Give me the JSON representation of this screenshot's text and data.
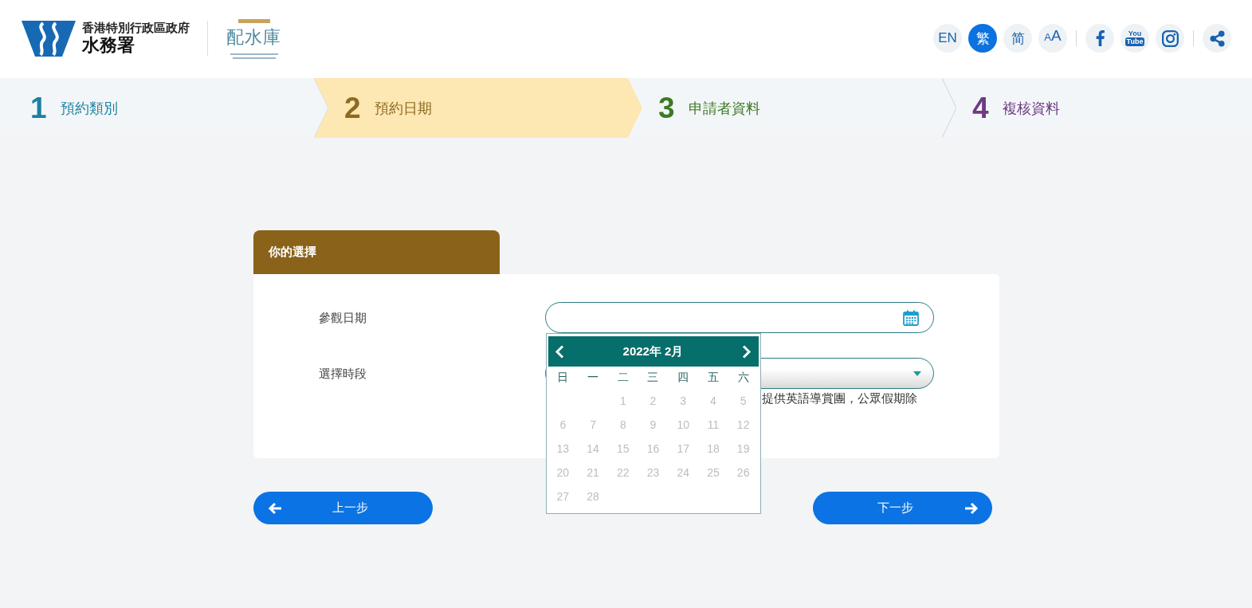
{
  "header": {
    "org_name": "香港特別行政區政府",
    "department": "水務署",
    "partner_logo": "配水庫",
    "languages": [
      {
        "label": "EN",
        "selected": false
      },
      {
        "label": "繁",
        "selected": true
      },
      {
        "label": "简",
        "selected": false
      }
    ],
    "font_size_button": {
      "small": "A",
      "large": "A"
    },
    "social": [
      {
        "kind": "facebook"
      },
      {
        "kind": "youtube",
        "top": "You",
        "bottom": "Tube"
      },
      {
        "kind": "instagram"
      }
    ]
  },
  "steps": [
    {
      "number": "1",
      "label": "預約類別",
      "color": "#1b80a0",
      "selected": false
    },
    {
      "number": "2",
      "label": "預約日期",
      "color": "#8e6a22",
      "selected": true
    },
    {
      "number": "3",
      "label": "申請者資料",
      "color": "#3e7a26",
      "selected": false
    },
    {
      "number": "4",
      "label": "複核資料",
      "color": "#6e3b82",
      "selected": false
    }
  ],
  "selection_panel": {
    "title": "你的選擇",
    "fields": [
      {
        "kind": "date",
        "label": "參觀日期",
        "calendar": {
          "title": "2022年 2月",
          "weekdays": [
            "日",
            "一",
            "二",
            "三",
            "四",
            "五",
            "六"
          ],
          "weeks": [
            {
              "flush_right": true,
              "days": [
                {
                  "day": "1",
                  "disabled": true
                },
                {
                  "day": "2",
                  "disabled": true
                },
                {
                  "day": "3",
                  "disabled": true
                },
                {
                  "day": "4",
                  "disabled": true
                },
                {
                  "day": "5",
                  "disabled": true
                }
              ]
            },
            {
              "days": [
                {
                  "day": "6",
                  "disabled": true
                },
                {
                  "day": "7",
                  "disabled": true
                },
                {
                  "day": "8",
                  "disabled": true
                },
                {
                  "day": "9",
                  "disabled": true
                },
                {
                  "day": "10",
                  "disabled": true
                },
                {
                  "day": "11",
                  "disabled": true
                },
                {
                  "day": "12",
                  "disabled": true
                }
              ]
            },
            {
              "days": [
                {
                  "day": "13",
                  "disabled": true
                },
                {
                  "day": "14",
                  "disabled": true
                },
                {
                  "day": "15",
                  "disabled": true
                },
                {
                  "day": "16",
                  "disabled": true
                },
                {
                  "day": "17",
                  "disabled": true
                },
                {
                  "day": "18",
                  "disabled": true
                },
                {
                  "day": "19",
                  "disabled": true
                }
              ]
            },
            {
              "days": [
                {
                  "day": "20",
                  "disabled": true
                },
                {
                  "day": "21",
                  "disabled": true
                },
                {
                  "day": "22",
                  "disabled": true
                },
                {
                  "day": "23",
                  "disabled": true
                },
                {
                  "day": "24",
                  "disabled": true
                },
                {
                  "day": "25",
                  "disabled": true
                },
                {
                  "day": "26",
                  "disabled": true
                }
              ]
            },
            {
              "flush_right": false,
              "days": [
                {
                  "day": "27",
                  "disabled": true
                },
                {
                  "day": "28",
                  "disabled": true
                }
              ]
            }
          ]
        }
      },
      {
        "kind": "select",
        "label": "選擇時段",
        "note": "提供英語導賞團，公眾假期除"
      }
    ]
  },
  "buttons": [
    {
      "kind": "back",
      "label": "上一步"
    },
    {
      "kind": "next",
      "label": "下一步"
    }
  ]
}
